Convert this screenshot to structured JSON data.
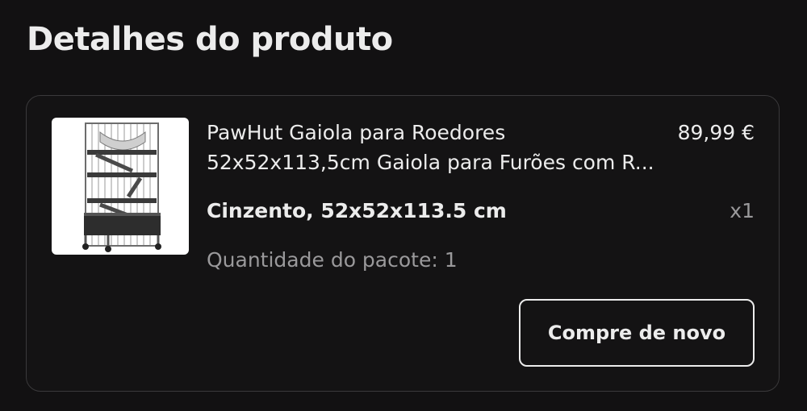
{
  "header": {
    "title": "Detalhes do produto"
  },
  "product": {
    "name": "PawHut Gaiola para Roedores 52x52x113,5cm Gaiola para Furões com R...",
    "price": "89,99 €",
    "variant": "Cinzento, 52x52x113.5 cm",
    "quantity": "x1",
    "package_quantity": "Quantidade do pacote: 1",
    "image_icon": "pet-cage-image"
  },
  "actions": {
    "buy_again_label": "Compre de novo"
  },
  "colors": {
    "background": "#121112",
    "card_border": "#3a393b",
    "text_primary": "#ececec",
    "text_secondary": "#9a999b"
  }
}
